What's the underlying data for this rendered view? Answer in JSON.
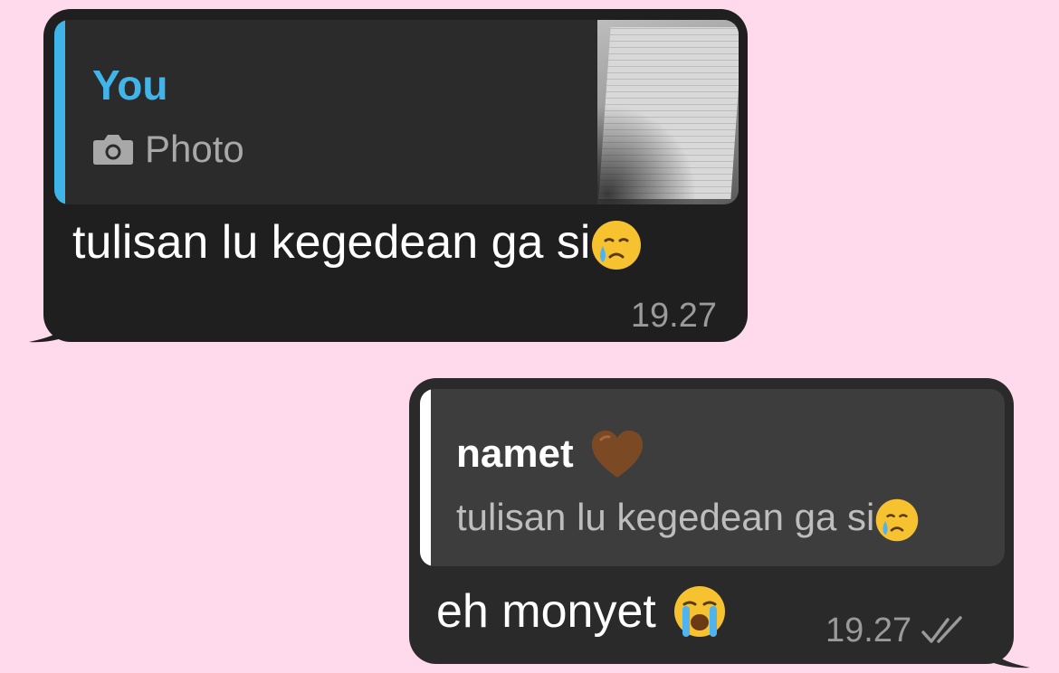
{
  "incoming": {
    "quote": {
      "author": "You",
      "media_label": "Photo",
      "media_icon": "camera-icon",
      "thumbnail": "photo-thumbnail"
    },
    "text": "tulisan lu kegedean ga si",
    "emoji": "face-holding-back-tears",
    "time": "19.27"
  },
  "outgoing": {
    "quote": {
      "author": "namet",
      "author_emoji": "brown-heart",
      "text": "tulisan lu kegedean ga si",
      "text_emoji": "face-holding-back-tears"
    },
    "text": "eh monyet",
    "emoji": "loudly-crying-face",
    "time": "19.27",
    "status_icon": "double-check-icon"
  },
  "colors": {
    "background": "#ffd9ec",
    "incoming_bubble": "#1f1f1f",
    "outgoing_bubble": "#2a2a2a",
    "quote_accent_incoming": "#3fb4e8",
    "quote_accent_outgoing": "#ffffff",
    "timestamp": "#9a9a9a"
  }
}
